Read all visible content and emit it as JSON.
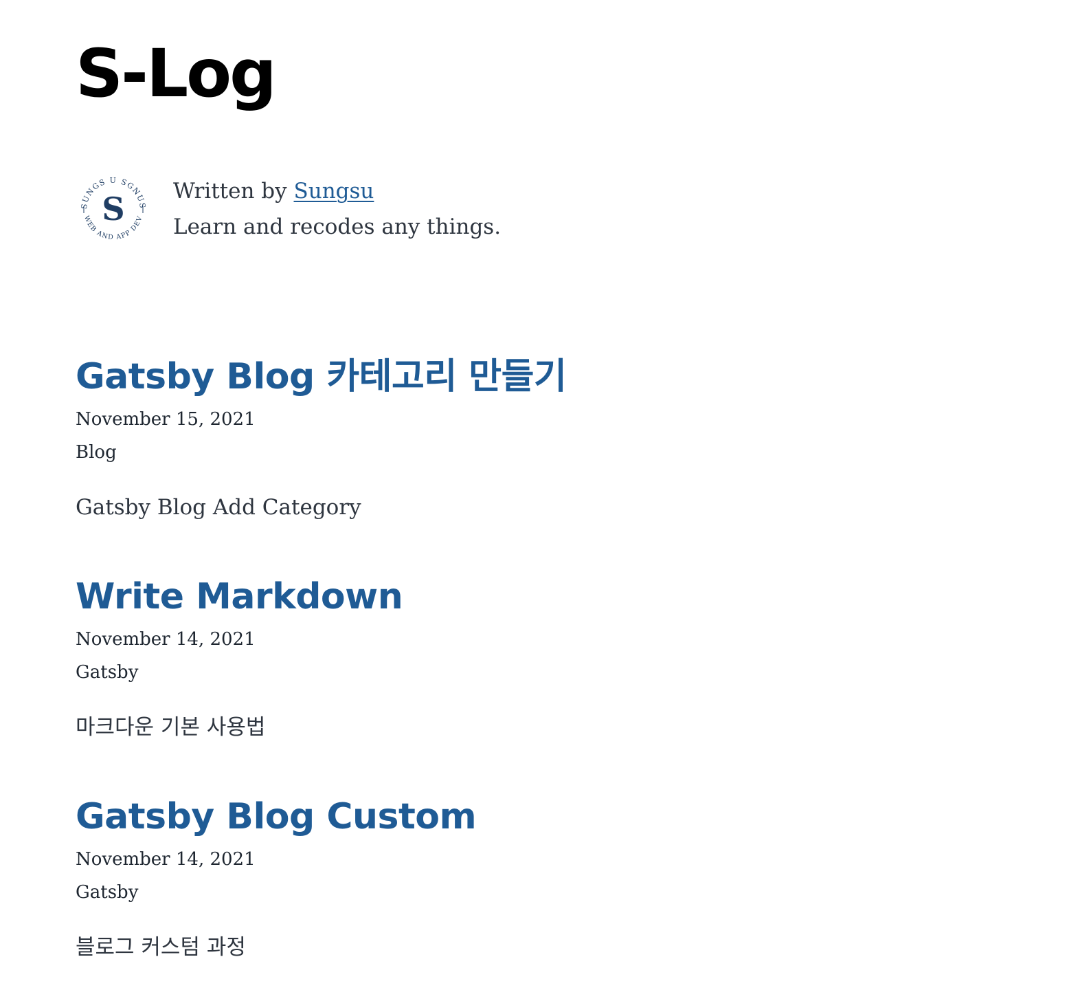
{
  "site": {
    "title": "S-Log"
  },
  "bio": {
    "prefix": "Written by ",
    "author": "Sungsu",
    "tagline": "Learn and recodes any things.",
    "avatar": {
      "letter": "S",
      "ring_top": "SUNGS U SGNUS",
      "ring_bottom": "WEB AND APP DEV",
      "color": "#1f3d63"
    }
  },
  "colors": {
    "link": "#1f5b95",
    "title": "#000000",
    "text": "#2e353f"
  },
  "posts": [
    {
      "title": "Gatsby Blog 카테고리 만들기",
      "date": "November 15, 2021",
      "category": "Blog",
      "description": "Gatsby Blog Add Category"
    },
    {
      "title": "Write Markdown",
      "date": "November 14, 2021",
      "category": "Gatsby",
      "description": "마크다운 기본 사용법"
    },
    {
      "title": "Gatsby Blog Custom",
      "date": "November 14, 2021",
      "category": "Gatsby",
      "description": "블로그 커스텀 과정"
    }
  ]
}
